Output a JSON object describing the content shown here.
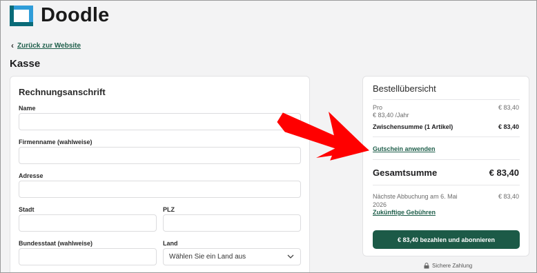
{
  "brand": {
    "name": "Doodle",
    "logo_icon": "doodle-logo-icon"
  },
  "nav": {
    "back_label": "Zurück zur Website"
  },
  "page": {
    "title": "Kasse"
  },
  "billing": {
    "title": "Rechnungsanschrift",
    "fields": {
      "name": {
        "label": "Name",
        "value": ""
      },
      "company": {
        "label": "Firmenname (wahlweise)",
        "value": ""
      },
      "address": {
        "label": "Adresse",
        "value": ""
      },
      "city": {
        "label": "Stadt",
        "value": ""
      },
      "zip": {
        "label": "PLZ",
        "value": ""
      },
      "state": {
        "label": "Bundesstaat (wahlweise)",
        "value": ""
      },
      "country": {
        "label": "Land",
        "selected": "Wählen Sie ein Land aus"
      }
    }
  },
  "summary": {
    "title": "Bestellübersicht",
    "plan_name": "Pro",
    "plan_price": "€ 83,40",
    "plan_period": "€ 83,40 /Jahr",
    "subtotal_label": "Zwischensumme (1 Artikel)",
    "subtotal_value": "€ 83,40",
    "coupon_link": "Gutschein anwenden",
    "total_label": "Gesamtsumme",
    "total_value": "€ 83,40",
    "next_charge_line1": "Nächste Abbuchung am 6. Mai",
    "next_charge_line2": "2026",
    "next_charge_value": "€ 83,40",
    "future_fees_link": "Zukünftige Gebühren",
    "pay_button": "€ 83,40 bezahlen und abonnieren",
    "secure_label": "Sichere Zahlung"
  },
  "annotation": {
    "color": "#ff0000",
    "icon": "red-arrow-annotation"
  },
  "colors": {
    "accent": "#1c5a47",
    "link": "#1e5e4a",
    "logo_dark": "#0a6b78",
    "logo_light": "#2f9dd9"
  }
}
